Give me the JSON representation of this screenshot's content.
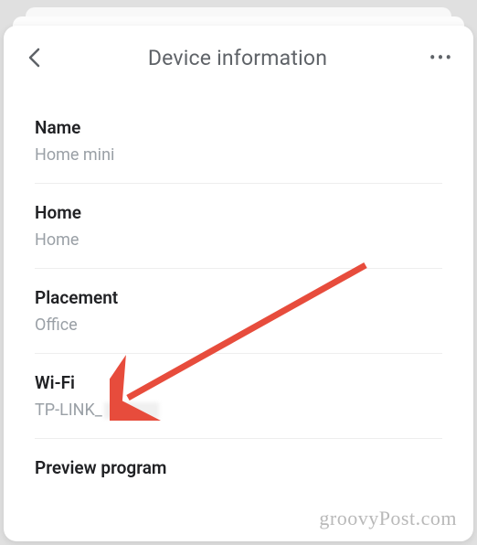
{
  "header": {
    "title": "Device information"
  },
  "sections": {
    "name": {
      "label": "Name",
      "value": "Home mini"
    },
    "home": {
      "label": "Home",
      "value": "Home"
    },
    "placement": {
      "label": "Placement",
      "value": "Office"
    },
    "wifi": {
      "label": "Wi-Fi",
      "value": "TP-LINK_"
    },
    "preview": {
      "label": "Preview program"
    }
  },
  "watermark": "groovyPost.com",
  "arrow": {
    "color": "#e74c3c"
  }
}
